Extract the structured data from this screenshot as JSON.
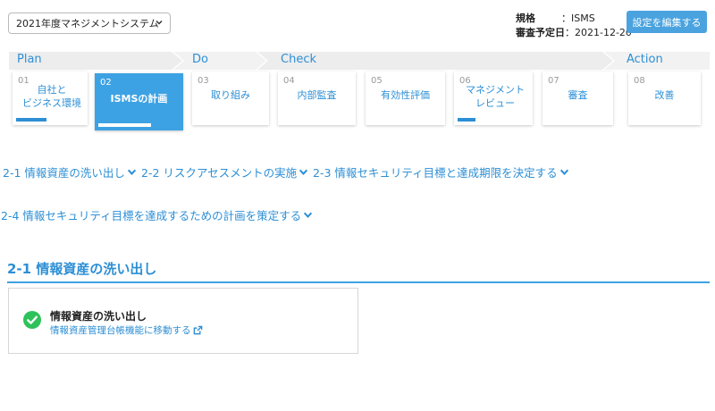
{
  "header": {
    "fiscal_select": {
      "value": "2021年度マネジメントシステム"
    },
    "standard": {
      "label": "規格",
      "value": "ISMS"
    },
    "review_date": {
      "label": "審査予定日",
      "value": "2021-12-20"
    },
    "edit_button": "設定を編集する"
  },
  "phases": {
    "plan": "Plan",
    "do": "Do",
    "check": "Check",
    "action": "Action"
  },
  "steps": [
    {
      "num": "01",
      "title": "自社と\nビジネス環境",
      "progress": 0.45,
      "active": false
    },
    {
      "num": "02",
      "title": "ISMSの計画",
      "progress": 0.65,
      "active": true
    },
    {
      "num": "03",
      "title": "取り組み",
      "progress": 0,
      "active": false
    },
    {
      "num": "04",
      "title": "内部監査",
      "progress": 0,
      "active": false
    },
    {
      "num": "05",
      "title": "有効性評価",
      "progress": 0,
      "active": false
    },
    {
      "num": "06",
      "title": "マネジメント\nレビュー",
      "progress": 0.25,
      "active": false
    },
    {
      "num": "07",
      "title": "審査",
      "progress": 0,
      "active": false
    },
    {
      "num": "08",
      "title": "改善",
      "progress": 0,
      "active": false
    }
  ],
  "anchors": [
    "2-1 情報資産の洗い出し",
    "2-2 リスクアセスメントの実施",
    "2-3 情報セキュリティ目標と達成期限を決定する",
    "2-4 情報セキュリティ目標を達成するための計画を策定する"
  ],
  "section": {
    "title": "2-1 情報資産の洗い出し",
    "item": {
      "title": "情報資産の洗い出し",
      "link": "情報資産管理台帳機能に移動する",
      "status": "completed"
    }
  },
  "colors": {
    "accent": "#2d8fd5",
    "active_card": "#3da2e3",
    "button": "#4aa3df",
    "check": "#2ec25a"
  }
}
